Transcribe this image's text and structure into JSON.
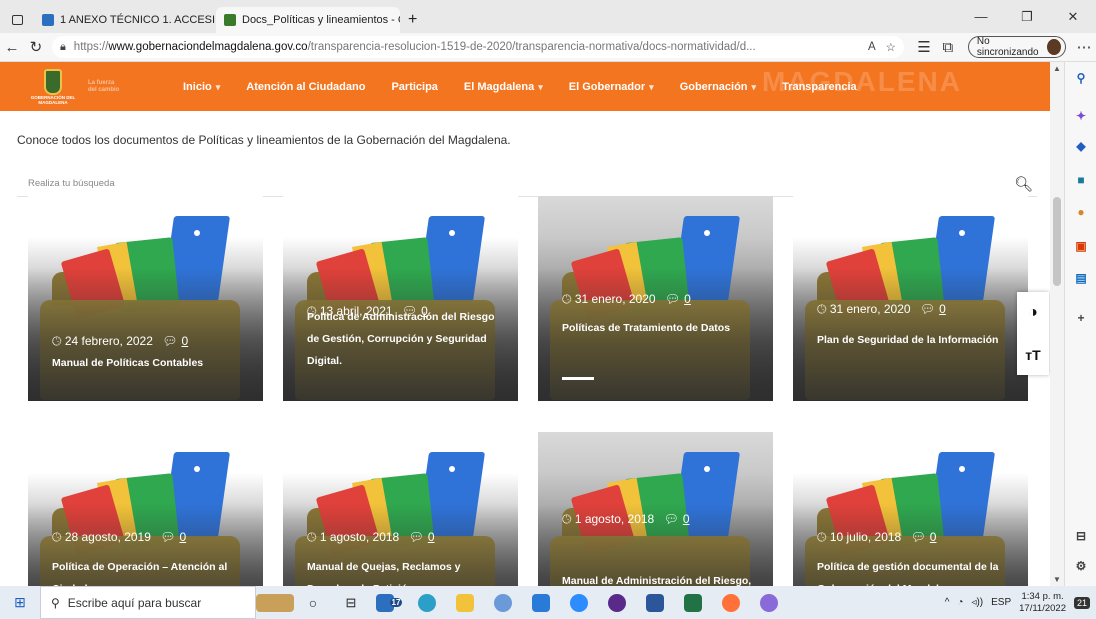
{
  "browser": {
    "tabs": [
      {
        "label": "1 ANEXO TÉCNICO 1. ACCESIBIL",
        "favicon_color": "#2c6fbf",
        "active": false
      },
      {
        "label": "Docs_Políticas y lineamientos - G",
        "favicon_color": "#3a7a2a",
        "active": true
      }
    ],
    "new_tab": "+",
    "window_controls": {
      "minimize": "—",
      "restore": "❐",
      "close": "✕"
    },
    "url_prefix": "https://",
    "url_host": "www.gobernaciondelmagdalena.gov.co",
    "url_path": "/transparencia-resolucion-1519-de-2020/transparencia-normativa/docs-normatividad/d...",
    "sync_label": "No sincronizando"
  },
  "site": {
    "logo_text1": "GOBERNACIÓN DEL MAGDALENA",
    "logo_text2": "La fuerza del cambio",
    "watermark": "MAGDALENA",
    "menu": [
      {
        "label": "Inicio",
        "dropdown": true
      },
      {
        "label": "Atención al Ciudadano",
        "dropdown": false
      },
      {
        "label": "Participa",
        "dropdown": false
      },
      {
        "label": "El Magdalena",
        "dropdown": true
      },
      {
        "label": "El Gobernador",
        "dropdown": true
      },
      {
        "label": "Gobernación",
        "dropdown": true
      },
      {
        "label": "Transparencia",
        "dropdown": false
      }
    ],
    "brand_color": "#f47520"
  },
  "content": {
    "intro": "Conoce todos los documentos de Políticas y lineamientos de la Gobernación del Magdalena.",
    "search_placeholder": "Realiza tu búsqueda",
    "documents": [
      {
        "date": "24 febrero, 2022",
        "comments": "0",
        "title": "Manual de Políticas Contables"
      },
      {
        "date": "13 abril, 2021",
        "comments": "0",
        "title": "Política de Administración del Riesgo de Gestión, Corrupción y Seguridad Digital."
      },
      {
        "date": "31 enero, 2020",
        "comments": "0",
        "title": "Políticas de Tratamiento de Datos"
      },
      {
        "date": "31 enero, 2020",
        "comments": "0",
        "title": "Plan de Seguridad de la Información"
      },
      {
        "date": "28 agosto, 2019",
        "comments": "0",
        "title": "Política de Operación – Atención al Ciudadano"
      },
      {
        "date": "1 agosto, 2018",
        "comments": "0",
        "title": "Manual de Quejas, Reclamos y Derechos de Petición"
      },
      {
        "date": "1 agosto, 2018",
        "comments": "0",
        "title": "Manual de Administración del Riesgo, Gobernación del Magdalena"
      },
      {
        "date": "10 julio, 2018",
        "comments": "0",
        "title": "Política de gestión documental de la Gobernación del Magdalena"
      }
    ]
  },
  "accessibility": {
    "contrast_icon": "◑",
    "text_size_icon": "тT"
  },
  "taskbar": {
    "search_placeholder": "Escribe aquí para buscar",
    "language": "ESP",
    "time": "1:34 p. m.",
    "date": "17/11/2022",
    "badge": "17",
    "notif": "21"
  }
}
